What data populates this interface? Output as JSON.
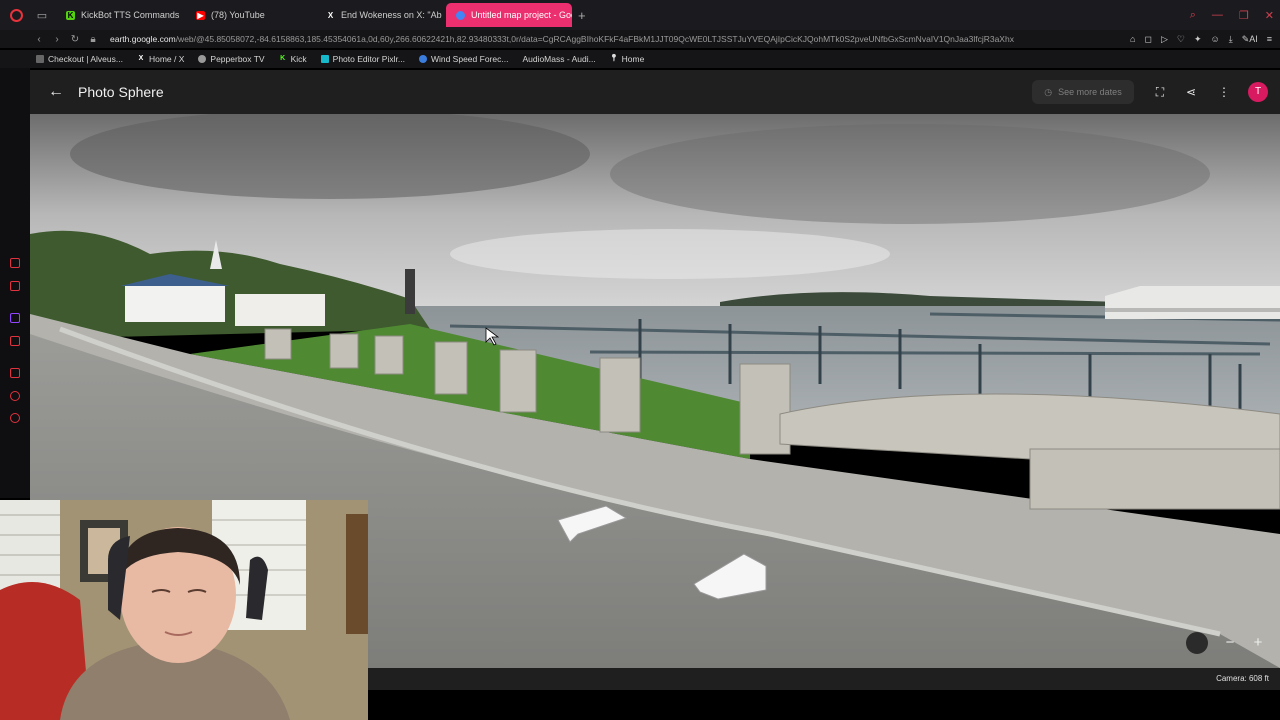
{
  "browser": {
    "tabs": [
      {
        "label": "KickBot TTS Commands",
        "icon": "kickbot-icon",
        "color": "#53d30f"
      },
      {
        "label": "(78) YouTube",
        "icon": "youtube-icon",
        "color": "#ff0000"
      },
      {
        "label": "End Wokeness on X: \"Abd...",
        "icon": "x-icon",
        "color": "#ffffff"
      },
      {
        "label": "Untitled map project - Goo...",
        "icon": "google-earth-icon",
        "color": "#4285f4",
        "active": true
      }
    ],
    "url_host": "earth.google.com",
    "url_path": "/web/@45.85058072,-84.6158863,185.45354061a,0d,60y,266.60622421h,82.93480333t,0r/data=CgRCAggBIhoKFkF4aFBkM1JJT09QcWE0LTJSSTJuYVEQAjIpCicKJQohMTk0S2pveUNfbGxScmNvaIV1QnJaa3lfcjR3aXhx",
    "bookmarks": [
      {
        "label": "Checkout | Alveus...",
        "icon": "cart-icon"
      },
      {
        "label": "Home / X",
        "icon": "x-icon"
      },
      {
        "label": "Pepperbox TV",
        "icon": "pepperbox-icon"
      },
      {
        "label": "Kick",
        "icon": "kick-icon"
      },
      {
        "label": "Photo Editor Pixlr...",
        "icon": "pixlr-icon"
      },
      {
        "label": "Wind Speed Forec...",
        "icon": "wind-icon"
      },
      {
        "label": "AudioMass - Audi...",
        "icon": "audiomass-icon"
      },
      {
        "label": "Home",
        "icon": "pin-icon"
      }
    ]
  },
  "earth": {
    "title": "Photo Sphere",
    "see_more_dates": "See more dates",
    "avatar_initial": "T",
    "camera_readout": "Camera: 608 ft",
    "accent": "#d81b60"
  }
}
